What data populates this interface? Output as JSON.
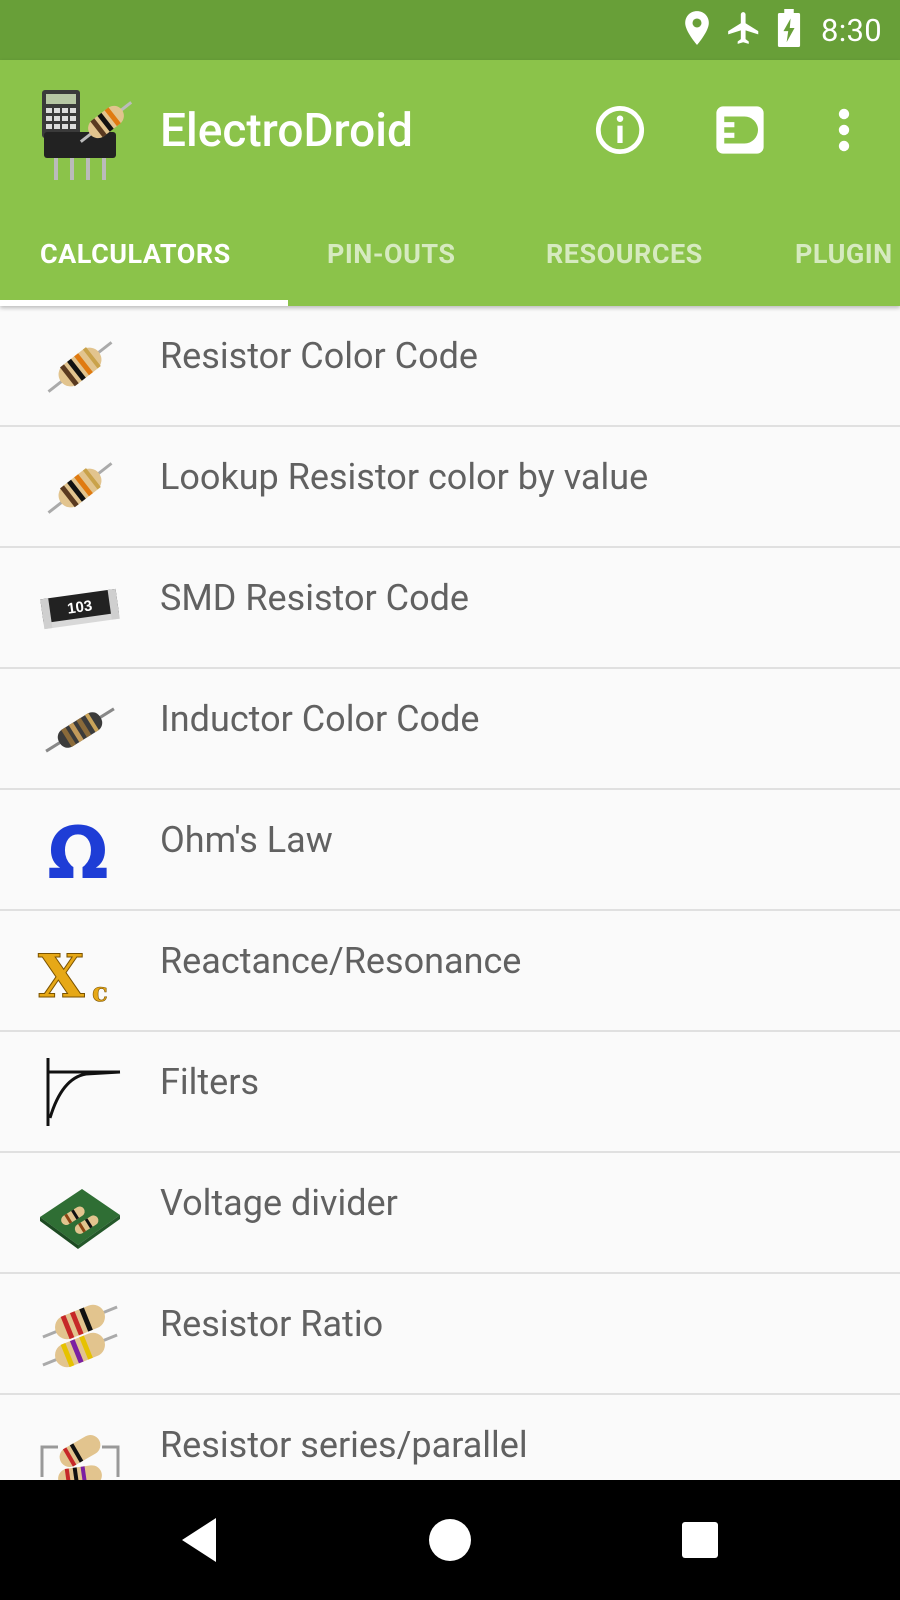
{
  "status_bar": {
    "time": "8:30",
    "icons": [
      "location-icon",
      "airplane-mode-icon",
      "battery-charging-icon"
    ]
  },
  "app_bar": {
    "title": "ElectroDroid",
    "actions": [
      "info-icon",
      "plugin-icon",
      "more-vert-icon"
    ]
  },
  "tabs": [
    {
      "label": "CALCULATORS",
      "active": true
    },
    {
      "label": "PIN-OUTS",
      "active": false
    },
    {
      "label": "RESOURCES",
      "active": false
    },
    {
      "label": "PLUGIN",
      "active": false
    }
  ],
  "calculators": [
    {
      "label": "Resistor Color Code",
      "icon": "resistor-icon"
    },
    {
      "label": "Lookup Resistor color by value",
      "icon": "resistor-icon"
    },
    {
      "label": "SMD Resistor Code",
      "icon": "smd-resistor-icon",
      "icon_text": "103"
    },
    {
      "label": "Inductor Color Code",
      "icon": "inductor-icon"
    },
    {
      "label": "Ohm's Law",
      "icon": "omega-icon"
    },
    {
      "label": "Reactance/Resonance",
      "icon": "reactance-icon"
    },
    {
      "label": "Filters",
      "icon": "filter-curve-icon"
    },
    {
      "label": "Voltage divider",
      "icon": "voltage-divider-icon"
    },
    {
      "label": "Resistor Ratio",
      "icon": "resistor-ratio-icon"
    },
    {
      "label": "Resistor series/parallel",
      "icon": "resistor-series-parallel-icon"
    }
  ],
  "nav_bar": [
    "back-icon",
    "home-icon",
    "recents-icon"
  ],
  "colors": {
    "status_bar": "#689f38",
    "app_bar": "#8bc34a",
    "list_background": "#fafafa",
    "text": "#616161",
    "divider": "#e0e0e0"
  }
}
